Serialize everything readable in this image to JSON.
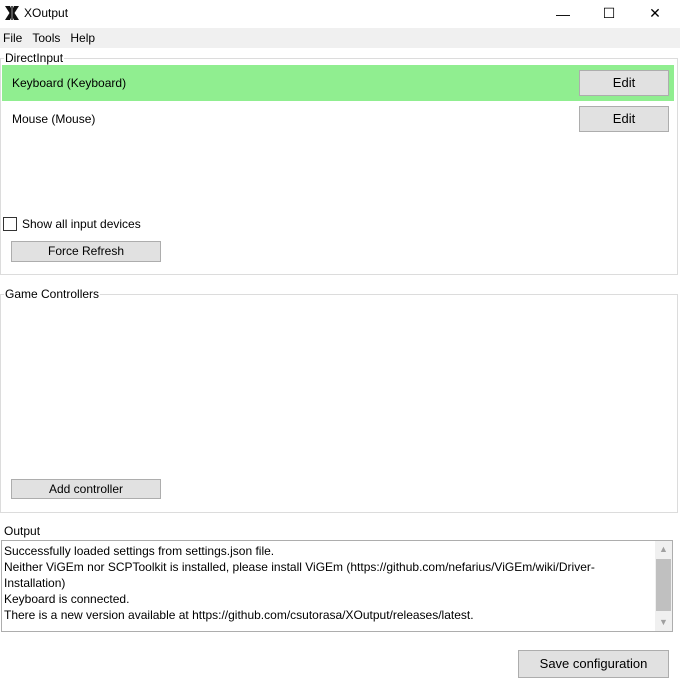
{
  "window": {
    "title": "XOutput",
    "minimize": "—",
    "maximize": "☐",
    "close": "✕"
  },
  "menu": [
    "File",
    "Tools",
    "Help"
  ],
  "direct_input": {
    "title": "DirectInput",
    "devices": [
      {
        "label": "Keyboard (Keyboard)",
        "edit": "Edit",
        "selected": true
      },
      {
        "label": "Mouse (Mouse)",
        "edit": "Edit",
        "selected": false
      }
    ],
    "show_all_label": "Show all input devices",
    "show_all_checked": false,
    "force_refresh": "Force Refresh"
  },
  "game_controllers": {
    "title": "Game Controllers",
    "add_controller": "Add controller"
  },
  "output": {
    "title": "Output",
    "text": "Successfully loaded settings from settings.json file.\nNeither ViGEm nor SCPToolkit is installed, please install ViGEm (https://github.com/nefarius/ViGEm/wiki/Driver-\nInstallation)\nKeyboard is connected.\nThere is a new version available at https://github.com/csutorasa/XOutput/releases/latest."
  },
  "save_configuration": "Save configuration",
  "colors": {
    "selected_row": "#90ee90",
    "button_bg": "#e1e1e1",
    "menubar_bg": "#f0f0f0"
  }
}
